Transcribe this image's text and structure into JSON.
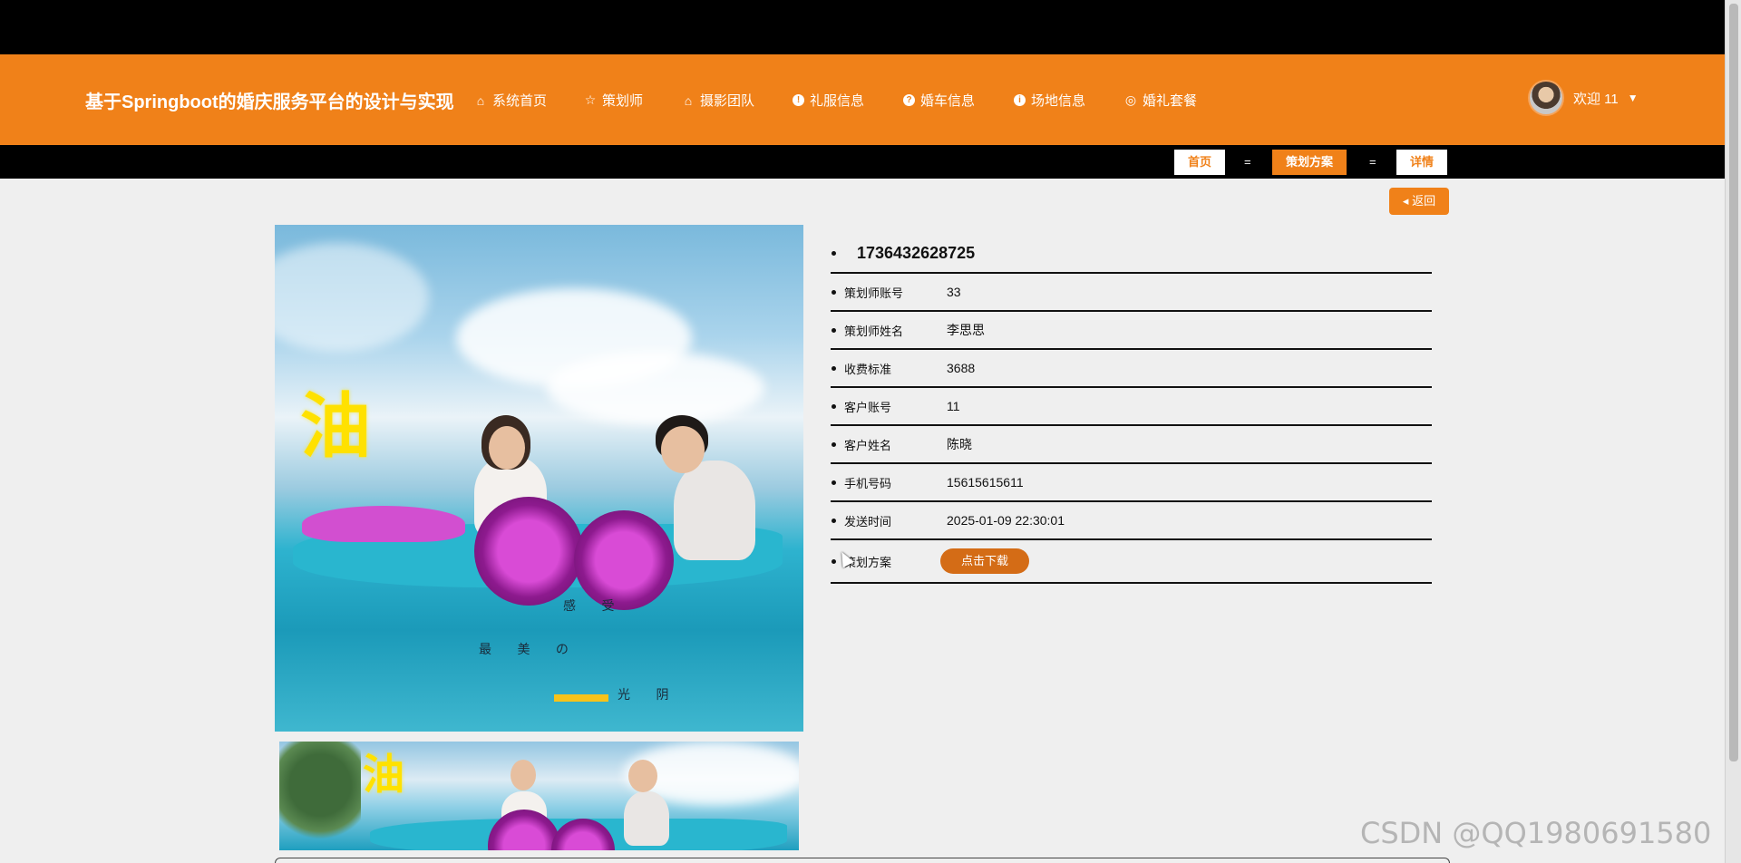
{
  "header": {
    "site_title": "基于Springboot的婚庆服务平台的设计与实现",
    "nav": [
      {
        "label": "系统首页",
        "icon": "home-icon",
        "glyph": "⌂"
      },
      {
        "label": "策划师",
        "icon": "star-icon",
        "glyph": "☆"
      },
      {
        "label": "摄影团队",
        "icon": "bag-icon",
        "glyph": "⌂"
      },
      {
        "label": "礼服信息",
        "icon": "info-circle-icon",
        "glyph": "!"
      },
      {
        "label": "婚车信息",
        "icon": "question-circle-icon",
        "glyph": "?"
      },
      {
        "label": "场地信息",
        "icon": "info-circle-icon",
        "glyph": "i"
      },
      {
        "label": "婚礼套餐",
        "icon": "globe-icon",
        "glyph": "◎"
      }
    ],
    "user": {
      "welcome": "欢迎 11",
      "caret": "▼"
    }
  },
  "breadcrumb": {
    "items": [
      "首页",
      "策划方案",
      "详情"
    ],
    "separator": "="
  },
  "back_button": {
    "label": "返回",
    "icon": "caret-left-icon",
    "glyph": "◂"
  },
  "gallery": {
    "poster_texts": [
      "感 受",
      "最 美 の",
      "光 阴"
    ],
    "poster_glyph": "油"
  },
  "detail": {
    "id": "1736432628725",
    "fields": [
      {
        "label": "策划师账号",
        "value": "33"
      },
      {
        "label": "策划师姓名",
        "value": "李思思"
      },
      {
        "label": "收费标准",
        "value": "3688"
      },
      {
        "label": "客户账号",
        "value": "11"
      },
      {
        "label": "客户姓名",
        "value": "陈晓"
      },
      {
        "label": "手机号码",
        "value": "15615615611"
      },
      {
        "label": "发送时间",
        "value": "2025-01-09 22:30:01"
      }
    ],
    "plan_label": "策划方案",
    "download_label": "点击下载"
  },
  "watermark": "CSDN @QQ1980691580",
  "colors": {
    "accent": "#f08119",
    "download": "#d46c16"
  }
}
